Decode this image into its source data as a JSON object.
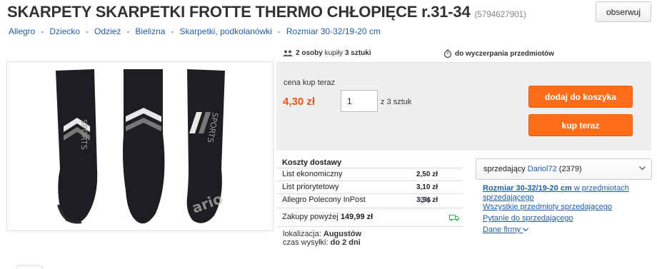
{
  "header": {
    "title": "SKARPETY SKARPETKI FROTTE THERMO CHŁOPIĘCE r.31-34",
    "item_id": "(5794627901)",
    "observe_label": "obserwuj"
  },
  "breadcrumb": [
    "Allegro",
    "Dziecko",
    "Odzież",
    "Bielizna",
    "Skarpetki, podkolanówki",
    "Rozmiar 30-32/19-20 cm"
  ],
  "photo": {
    "sock_text": "SPORTS",
    "watermark": "ario"
  },
  "stats": {
    "buyers_count": "2 osoby",
    "buyers_mid": "kupiły",
    "buyers_qty": "3 sztuki",
    "until_label": "do wyczerpania przedmiotów"
  },
  "buybox": {
    "price_label": "cena kup teraz",
    "price": "4,30 zł",
    "quantity": "1",
    "quantity_of": "z 3 sztuk",
    "add_to_cart": "dodaj do koszyka",
    "buy_now": "kup teraz"
  },
  "shipping": {
    "title": "Koszty dostawy",
    "rows": [
      {
        "name": "List ekonomiczny",
        "price": "2,50 zł"
      },
      {
        "name": "List priorytetowy",
        "price": "3,10 zł"
      },
      {
        "name": "Allegro Polecony InPost",
        "price": "3,94 zł"
      }
    ],
    "free_label": "Zakupy powyżej",
    "free_amount": "149,99 zł"
  },
  "location": {
    "location_label": "lokalizacja:",
    "location_value": "Augustów",
    "dispatch_label": "czas wysyłki:",
    "dispatch_value": "do 2 dni"
  },
  "seller": {
    "label": "sprzedający",
    "name": "Dariol72",
    "rating": "(2379)",
    "link_category_bold": "Rozmiar 30-32/19-20 cm",
    "link_category_rest": "w przedmiotach sprzedającego",
    "link_all": "Wszystkie przedmioty sprzedającego",
    "link_ask": "Pytanie do sprzedającego",
    "link_company": "Dane firmy"
  },
  "colors": {
    "accent_orange": "#ff6d1b",
    "price_orange": "#e55a1a",
    "link_blue": "#1f5fa8",
    "free_ship_green": "#3ab54a"
  }
}
